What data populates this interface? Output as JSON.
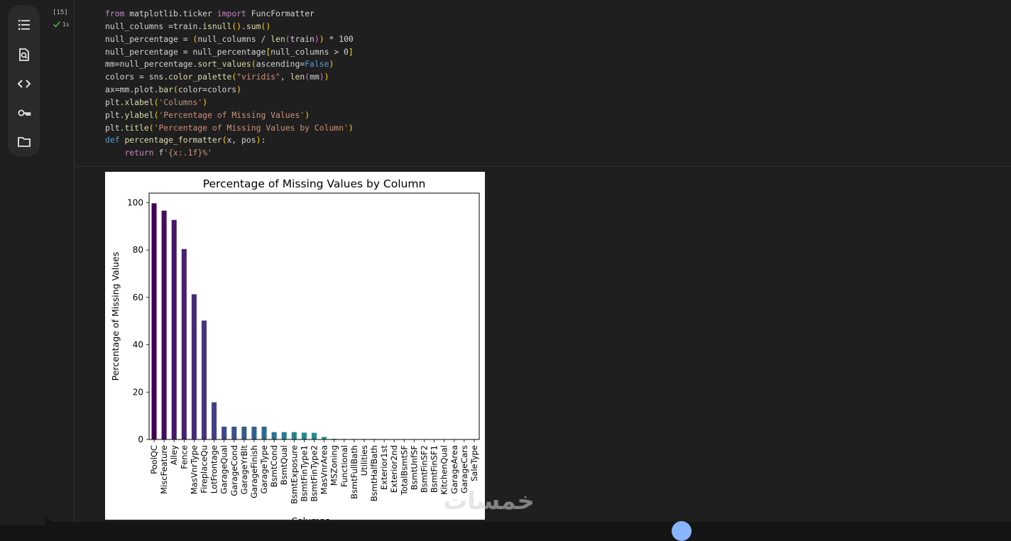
{
  "toolbar": {
    "items": [
      {
        "name": "table-of-contents",
        "icon": "list-icon"
      },
      {
        "name": "find-replace",
        "icon": "search-document-icon"
      },
      {
        "name": "code-snippets",
        "icon": "code-icon"
      },
      {
        "name": "secrets",
        "icon": "key-icon"
      },
      {
        "name": "files",
        "icon": "folder-icon"
      }
    ]
  },
  "cell": {
    "execution_count": "[15]",
    "status_time": "1s",
    "status_color": "#4caf50"
  },
  "code_lines": [
    "from matplotlib.ticker import FuncFormatter",
    "null_columns =train.isnull().sum()",
    "null_percentage = (null_columns / len(train)) * 100",
    "null_percentage = null_percentage[null_columns > 0]",
    "mm=null_percentage.sort_values(ascending=False)",
    "colors = sns.color_palette(\"viridis\", len(mm))",
    "ax=mm.plot.bar(color=colors)",
    "plt.xlabel('Columns')",
    "plt.ylabel('Percentage of Missing Values')",
    "plt.title('Percentage of Missing Values by Column')",
    "def percentage_formatter(x, pos):",
    "    return f'{x:.1f}%'"
  ],
  "chart_data": {
    "type": "bar",
    "title": "Percentage of Missing Values by Column",
    "xlabel": "Columns",
    "ylabel": "Percentage of Missing Values",
    "ylim": [
      0,
      104
    ],
    "yticks": [
      0,
      20,
      40,
      60,
      80,
      100
    ],
    "grid": false,
    "palette": "viridis",
    "categories": [
      "PoolQC",
      "MiscFeature",
      "Alley",
      "Fence",
      "MasVnrType",
      "FireplaceQu",
      "LotFrontage",
      "GarageQual",
      "GarageCond",
      "GarageYrBlt",
      "GarageFinish",
      "GarageType",
      "BsmtCond",
      "BsmtQual",
      "BsmtExposure",
      "BsmtFinType1",
      "BsmtFinType2",
      "MasVnrArea",
      "MSZoning",
      "Functional",
      "BsmtFullBath",
      "Utilities",
      "BsmtHalfBath",
      "Exterior1st",
      "Exterior2nd",
      "TotalBsmtSF",
      "BsmtUnfSF",
      "BsmtFinSF2",
      "BsmtFinSF1",
      "KitchenQual",
      "GarageArea",
      "GarageCars",
      "SaleType"
    ],
    "values": [
      99.7,
      96.6,
      92.7,
      80.4,
      61.3,
      50.2,
      15.7,
      5.4,
      5.4,
      5.4,
      5.4,
      5.4,
      3.1,
      3.1,
      3.1,
      2.9,
      2.8,
      1.1,
      0.3,
      0.2,
      0.2,
      0.2,
      0.2,
      0.1,
      0.1,
      0.1,
      0.1,
      0.1,
      0.1,
      0.1,
      0.1,
      0.1,
      0.1
    ]
  },
  "watermark": "خمسات"
}
